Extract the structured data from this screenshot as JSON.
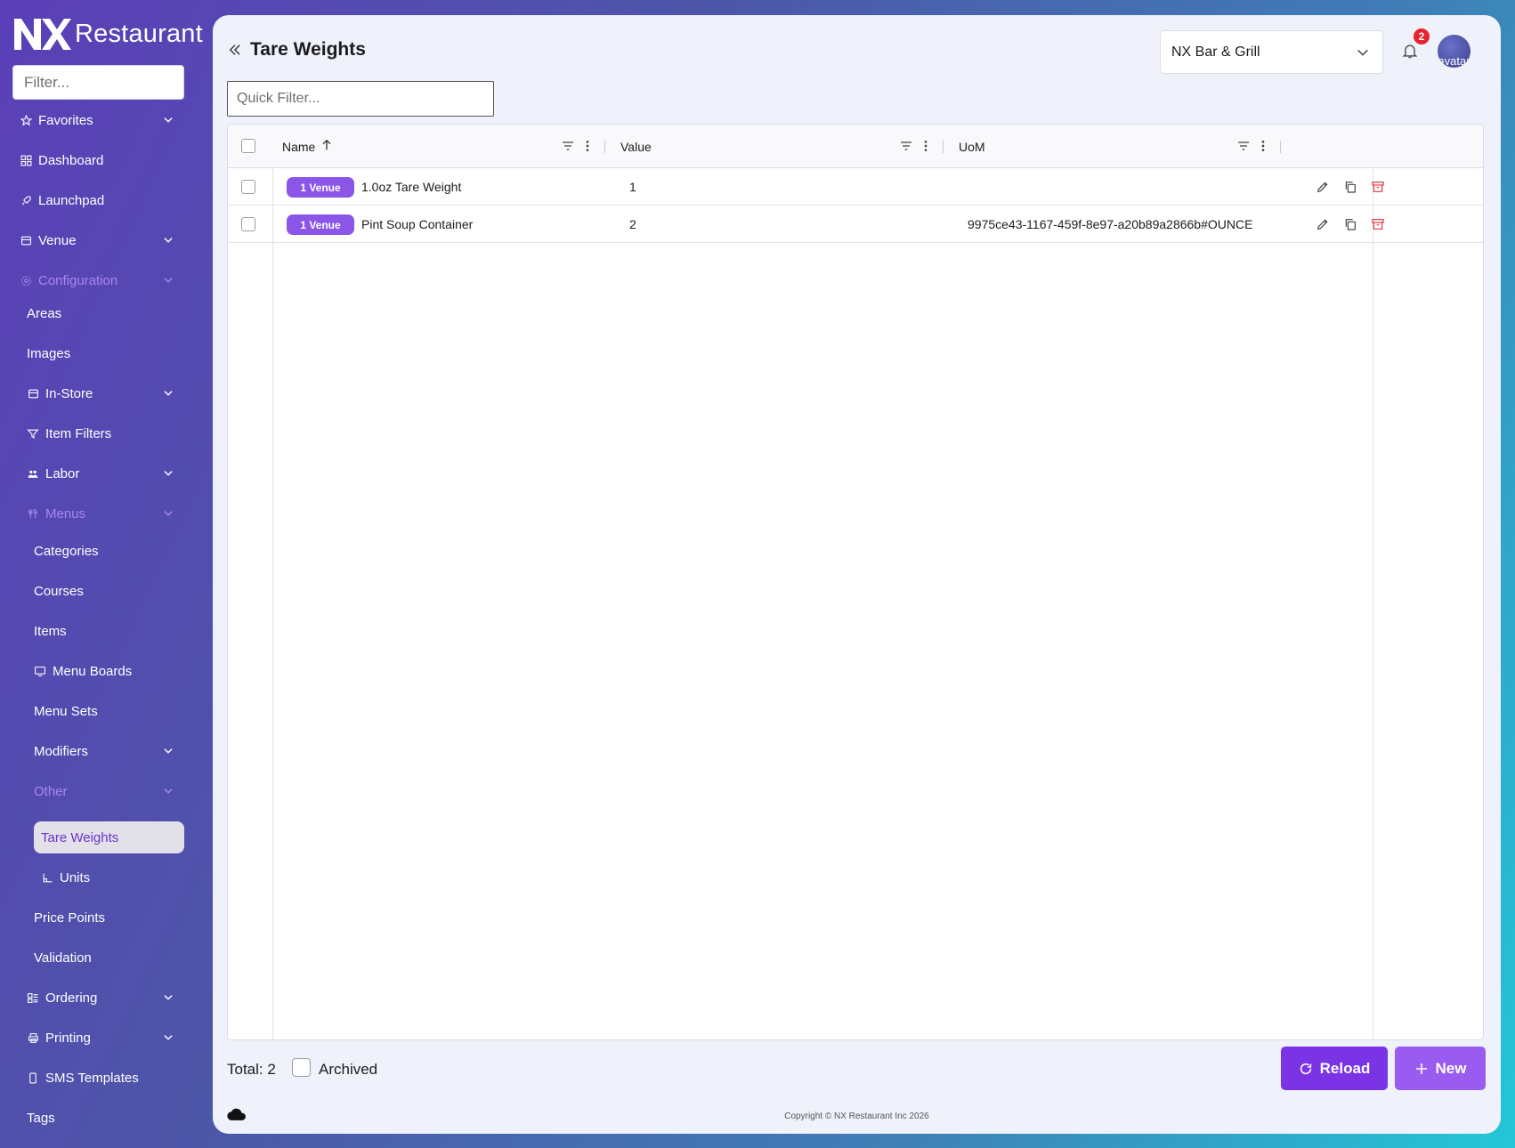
{
  "brand": {
    "logo_mark": "NX",
    "name": "Restaurant"
  },
  "sidebar": {
    "filter_placeholder": "Filter...",
    "items": [
      {
        "label": "Favorites",
        "icon": "star-icon"
      },
      {
        "label": "Dashboard",
        "icon": "dashboard-icon"
      },
      {
        "label": "Launchpad",
        "icon": "rocket-icon"
      },
      {
        "label": "Venue",
        "icon": "store-icon"
      },
      {
        "label": "Configuration",
        "icon": "gear-icon"
      },
      {
        "label": "Areas"
      },
      {
        "label": "Images"
      },
      {
        "label": "In-Store",
        "icon": "store-icon"
      },
      {
        "label": "Item Filters",
        "icon": "filter-icon"
      },
      {
        "label": "Labor",
        "icon": "people-icon"
      },
      {
        "label": "Menus",
        "icon": "utensils-icon"
      },
      {
        "label": "Categories"
      },
      {
        "label": "Courses"
      },
      {
        "label": "Items"
      },
      {
        "label": "Menu Boards",
        "icon": "monitor-icon"
      },
      {
        "label": "Menu Sets"
      },
      {
        "label": "Modifiers"
      },
      {
        "label": "Other"
      },
      {
        "label": "Tare Weights"
      },
      {
        "label": "Units",
        "icon": "ruler-icon"
      },
      {
        "label": "Price Points"
      },
      {
        "label": "Validation"
      },
      {
        "label": "Ordering",
        "icon": "ordering-icon"
      },
      {
        "label": "Printing",
        "icon": "printer-icon"
      },
      {
        "label": "SMS Templates",
        "icon": "phone-icon"
      },
      {
        "label": "Tags"
      }
    ]
  },
  "header": {
    "title": "Tare Weights",
    "venue": "NX Bar & Grill",
    "notification_count": "2",
    "avatar_alt": "avatar"
  },
  "grid": {
    "quick_filter_placeholder": "Quick Filter...",
    "columns": [
      "Name",
      "Value",
      "UoM"
    ],
    "sort": {
      "column": "Name",
      "direction": "ascending"
    },
    "rows": [
      {
        "tag": "1 Venue",
        "name": "1.0oz Tare Weight",
        "value": "1",
        "uom": ""
      },
      {
        "tag": "1 Venue",
        "name": "Pint Soup Container",
        "value": "2",
        "uom": "9975ce43-1167-459f-8e97-a20b89a2866b#OUNCE"
      }
    ]
  },
  "footer": {
    "total": "Total: 2",
    "archived_label": "Archived",
    "reload_label": "Reload",
    "new_label": "New",
    "copyright": "Copyright © NX Restaurant Inc 2026"
  },
  "colors": {
    "accent": "#7a34e6",
    "accent_light": "#9a5cf0",
    "pill": "#8b55e8",
    "delete": "#e0353f",
    "badge": "#e8232f"
  }
}
